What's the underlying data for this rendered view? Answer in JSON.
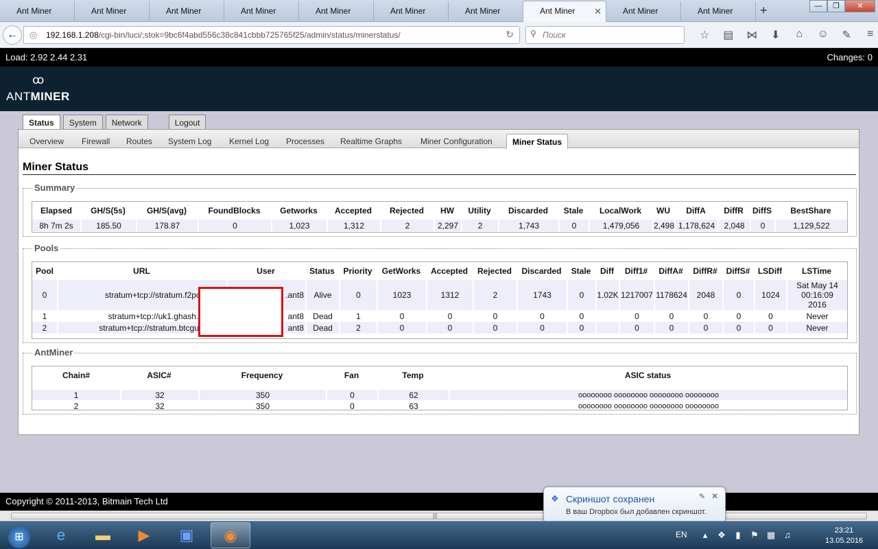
{
  "browser": {
    "tabs": [
      "Ant Miner",
      "Ant Miner",
      "Ant Miner",
      "Ant Miner",
      "Ant Miner",
      "Ant Miner",
      "Ant Miner",
      "Ant Miner",
      "Ant Miner",
      "Ant Miner"
    ],
    "active_tab_index": 7,
    "url_host": "192.168.1.208",
    "url_path": "/cgi-bin/luci/;stok=9bc6f4abd556c38c841cbbb725765f25/admin/status/minerstatus/",
    "search_placeholder": "Поиск",
    "new_tab_glyph": "+",
    "close_glyph": "✕"
  },
  "top": {
    "load": "Load: 2.92 2.44 2.31",
    "changes": "Changes: 0",
    "logo_prefix": "ANT",
    "logo_suffix": "MINER"
  },
  "main_tabs": {
    "status": "Status",
    "system": "System",
    "network": "Network",
    "logout": "Logout"
  },
  "sub_tabs": {
    "overview": "Overview",
    "firewall": "Firewall",
    "routes": "Routes",
    "syslog": "System Log",
    "kernel": "Kernel Log",
    "processes": "Processes",
    "graphs": "Realtime Graphs",
    "config": "Miner Configuration",
    "minerstatus": "Miner Status"
  },
  "page_title": "Miner Status",
  "summary": {
    "legend": "Summary",
    "headers": [
      "Elapsed",
      "GH/S(5s)",
      "GH/S(avg)",
      "FoundBlocks",
      "Getworks",
      "Accepted",
      "Rejected",
      "HW",
      "Utility",
      "Discarded",
      "Stale",
      "LocalWork",
      "WU",
      "DiffA",
      "DiffR",
      "DiffS",
      "BestShare"
    ],
    "row": [
      "8h 7m 2s",
      "185.50",
      "178.87",
      "0",
      "1,023",
      "1,312",
      "2",
      "2,297",
      "2",
      "1,743",
      "0",
      "1,479,056",
      "2,498",
      "1,178,624",
      "2,048",
      "0",
      "1,129,522"
    ]
  },
  "pools": {
    "legend": "Pools",
    "headers": [
      "Pool",
      "URL",
      "User",
      "Status",
      "Priority",
      "GetWorks",
      "Accepted",
      "Rejected",
      "Discarded",
      "Stale",
      "Diff",
      "Diff1#",
      "DiffA#",
      "DiffR#",
      "DiffS#",
      "LSDiff",
      "LSTime"
    ],
    "rows": [
      {
        "pool": "0",
        "url": "stratum+tcp://stratum.f2pool.com",
        "user": ".ant8",
        "status": "Alive",
        "priority": "0",
        "getworks": "1023",
        "accepted": "1312",
        "rejected": "2",
        "discarded": "1743",
        "stale": "0",
        "diff": "1.02K",
        "diff1": "1217007",
        "diffa": "1178624",
        "diffr": "2048",
        "diffs": "0",
        "lsdiff": "1024",
        "lstime1": "Sat May 14",
        "lstime2": "00:16:09",
        "lstime3": "2016"
      },
      {
        "pool": "1",
        "url": "stratum+tcp://uk1.ghash.io:333",
        "user": "ant8",
        "status": "Dead",
        "priority": "1",
        "getworks": "0",
        "accepted": "0",
        "rejected": "0",
        "discarded": "0",
        "stale": "0",
        "diff": "",
        "diff1": "0",
        "diffa": "0",
        "diffr": "0",
        "diffs": "0",
        "lsdiff": "0",
        "lstime": "Never"
      },
      {
        "pool": "2",
        "url": "stratum+tcp://stratum.btcguild.com",
        "user": "ant8",
        "status": "Dead",
        "priority": "2",
        "getworks": "0",
        "accepted": "0",
        "rejected": "0",
        "discarded": "0",
        "stale": "0",
        "diff": "",
        "diff1": "0",
        "diffa": "0",
        "diffr": "0",
        "diffs": "0",
        "lsdiff": "0",
        "lstime": "Never"
      }
    ]
  },
  "antminer": {
    "legend": "AntMiner",
    "headers": [
      "Chain#",
      "ASIC#",
      "Frequency",
      "Fan",
      "Temp",
      "ASIC status"
    ],
    "rows": [
      {
        "chain": "1",
        "asic": "32",
        "freq": "350",
        "fan": "0",
        "temp": "62",
        "status": "oooooooo oooooooo oooooooo oooooooo"
      },
      {
        "chain": "2",
        "asic": "32",
        "freq": "350",
        "fan": "0",
        "temp": "63",
        "status": "oooooooo oooooooo oooooooo oooooooo"
      }
    ]
  },
  "footer": "Copyright © 2011-2013, Bitmain Tech Ltd",
  "toast": {
    "title": "Скриншот сохранен",
    "message": "В ваш Dropbox был добавлен скриншот."
  },
  "taskbar": {
    "lang": "EN",
    "time": "23:21",
    "date": "13.05.2016"
  },
  "colors": {
    "header_bg": "#0c2231",
    "load_bar_bg": "#000000",
    "row_alt": "#eeeefa",
    "redaction_border": "#dd1111"
  }
}
